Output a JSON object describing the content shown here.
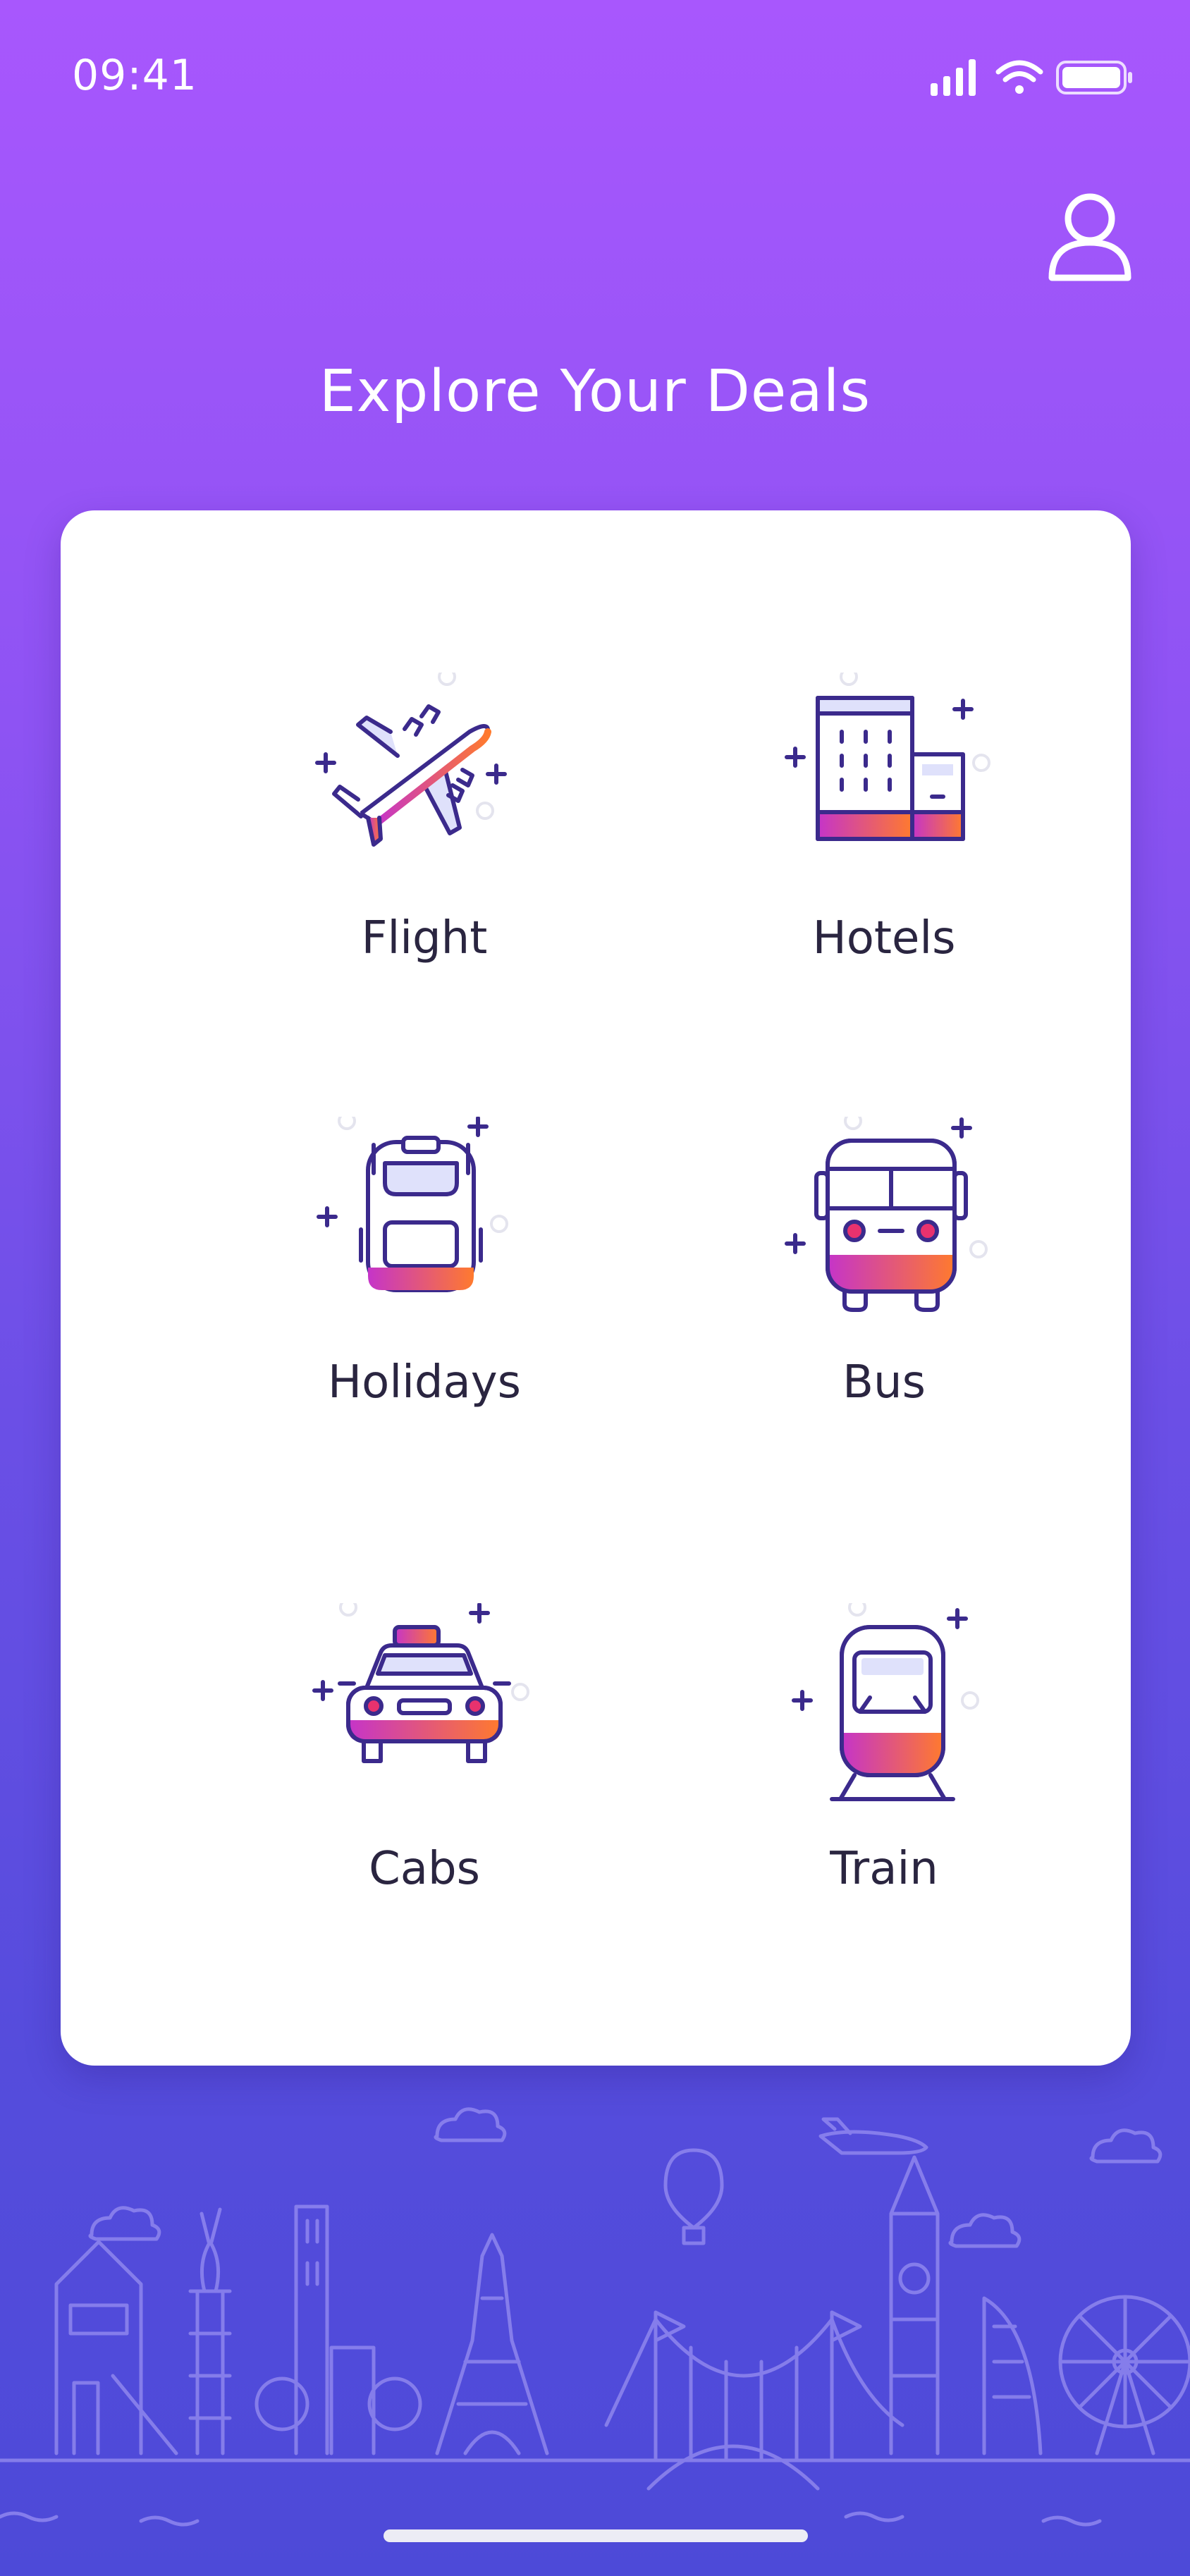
{
  "status_bar": {
    "time": "09:41",
    "icons": [
      "cellular-signal-icon",
      "wifi-icon",
      "battery-icon"
    ]
  },
  "header": {
    "profile_icon": "user-icon",
    "title": "Explore Your Deals"
  },
  "categories": [
    {
      "label": "Flight",
      "icon": "airplane-icon"
    },
    {
      "label": "Hotels",
      "icon": "hotel-icon"
    },
    {
      "label": "Holidays",
      "icon": "backpack-icon"
    },
    {
      "label": "Bus",
      "icon": "bus-icon"
    },
    {
      "label": "Cabs",
      "icon": "taxi-icon"
    },
    {
      "label": "Train",
      "icon": "train-icon"
    }
  ],
  "colors": {
    "background_top": "#a857fd",
    "background_bottom": "#4d4ad8",
    "icon_outline": "#3b2a8c",
    "icon_fill_light": "#dfe1fb",
    "accent_gradient_start": "#c534c9",
    "accent_gradient_end": "#ff7a2e"
  }
}
